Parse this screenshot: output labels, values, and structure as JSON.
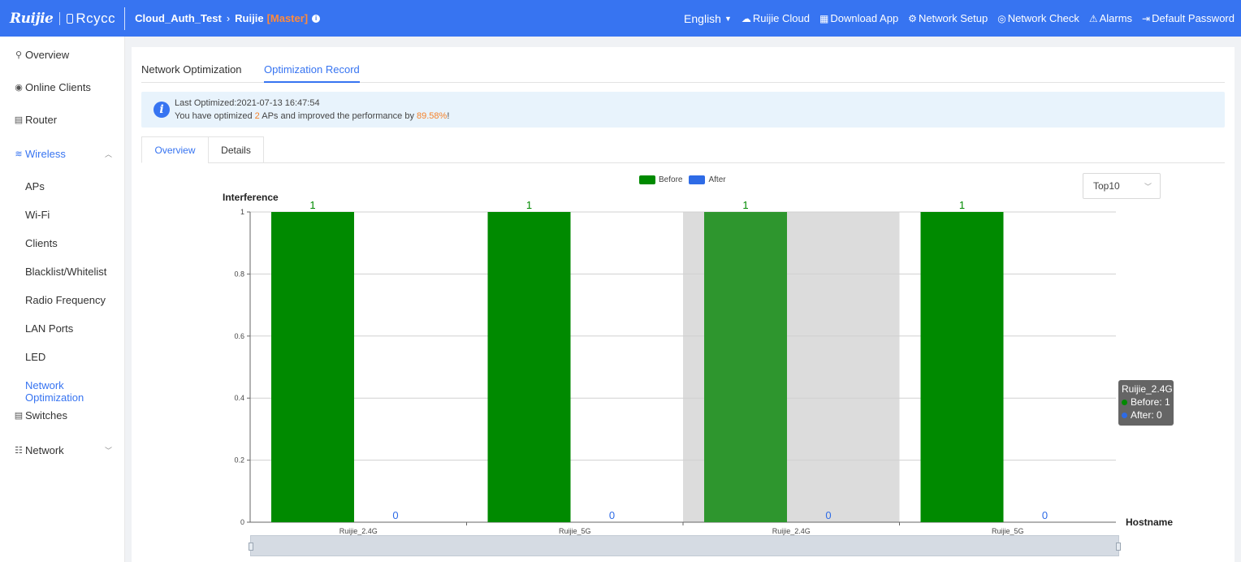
{
  "header": {
    "brand_ruijie": "Ruijie",
    "brand_reyee": "Rcycc",
    "project": "Cloud_Auth_Test",
    "device": "Ruijie",
    "role": "[Master]",
    "language": "English",
    "nav": [
      {
        "label": "Ruijie Cloud",
        "icon": "cloud-icon"
      },
      {
        "label": "Download App",
        "icon": "qrcode-icon"
      },
      {
        "label": "Network Setup",
        "icon": "network-setup-icon"
      },
      {
        "label": "Network Check",
        "icon": "network-check-icon"
      },
      {
        "label": "Alarms",
        "icon": "alarm-icon"
      },
      {
        "label": "Default Password",
        "icon": "logout-icon"
      }
    ]
  },
  "sidebar": {
    "items": [
      {
        "label": "Overview",
        "icon": "topology-icon"
      },
      {
        "label": "Online Clients",
        "icon": "user-circle-icon"
      },
      {
        "label": "Router",
        "icon": "router-icon"
      },
      {
        "label": "Wireless",
        "icon": "wifi-icon"
      },
      {
        "label": "Switches",
        "icon": "switch-icon"
      },
      {
        "label": "Network",
        "icon": "sliders-icon"
      }
    ],
    "wireless_sub": [
      "APs",
      "Wi-Fi",
      "Clients",
      "Blacklist/Whitelist",
      "Radio Frequency",
      "LAN Ports",
      "LED",
      "Network Optimization"
    ],
    "active_sub": "Network Optimization"
  },
  "main": {
    "tabs": [
      "Network Optimization",
      "Optimization Record"
    ],
    "active_tab": "Optimization Record",
    "alert": {
      "line1": "Last Optimized:2021-07-13 16:47:54",
      "line2_pre": "You have optimized ",
      "aps": "2",
      "line2_mid": " APs and improved the performance by ",
      "percent": "89.58%",
      "line2_end": "!"
    },
    "subtabs": [
      "Overview",
      "Details"
    ],
    "active_subtab": "Overview",
    "select_value": "Top10"
  },
  "chart_data": {
    "type": "bar",
    "ylabel": "Interference",
    "xlabel": "Hostname",
    "categories": [
      "Ruijie_2.4G",
      "Ruijie_5G",
      "Ruijie_2.4G",
      "Ruijie_5G"
    ],
    "series": [
      {
        "name": "Before",
        "values": [
          1,
          1,
          1,
          1
        ],
        "color": "#008a00"
      },
      {
        "name": "After",
        "values": [
          0,
          0,
          0,
          0
        ],
        "color": "#2e6be6"
      }
    ],
    "ylim": [
      0,
      1
    ],
    "yticks": [
      "0",
      "0.2",
      "0.4",
      "0.6",
      "0.8",
      "1"
    ],
    "grid": true,
    "legend": "top-center",
    "highlighted_category_index": 2,
    "tooltip": {
      "title": "Ruijie_2.4G",
      "before": "Before: 1",
      "after": "After: 0"
    }
  },
  "colors": {
    "header": "#3774f1",
    "accent": "#3774f1",
    "highlight": "#f5822a",
    "before": "#008a00",
    "after": "#2e6be6"
  }
}
